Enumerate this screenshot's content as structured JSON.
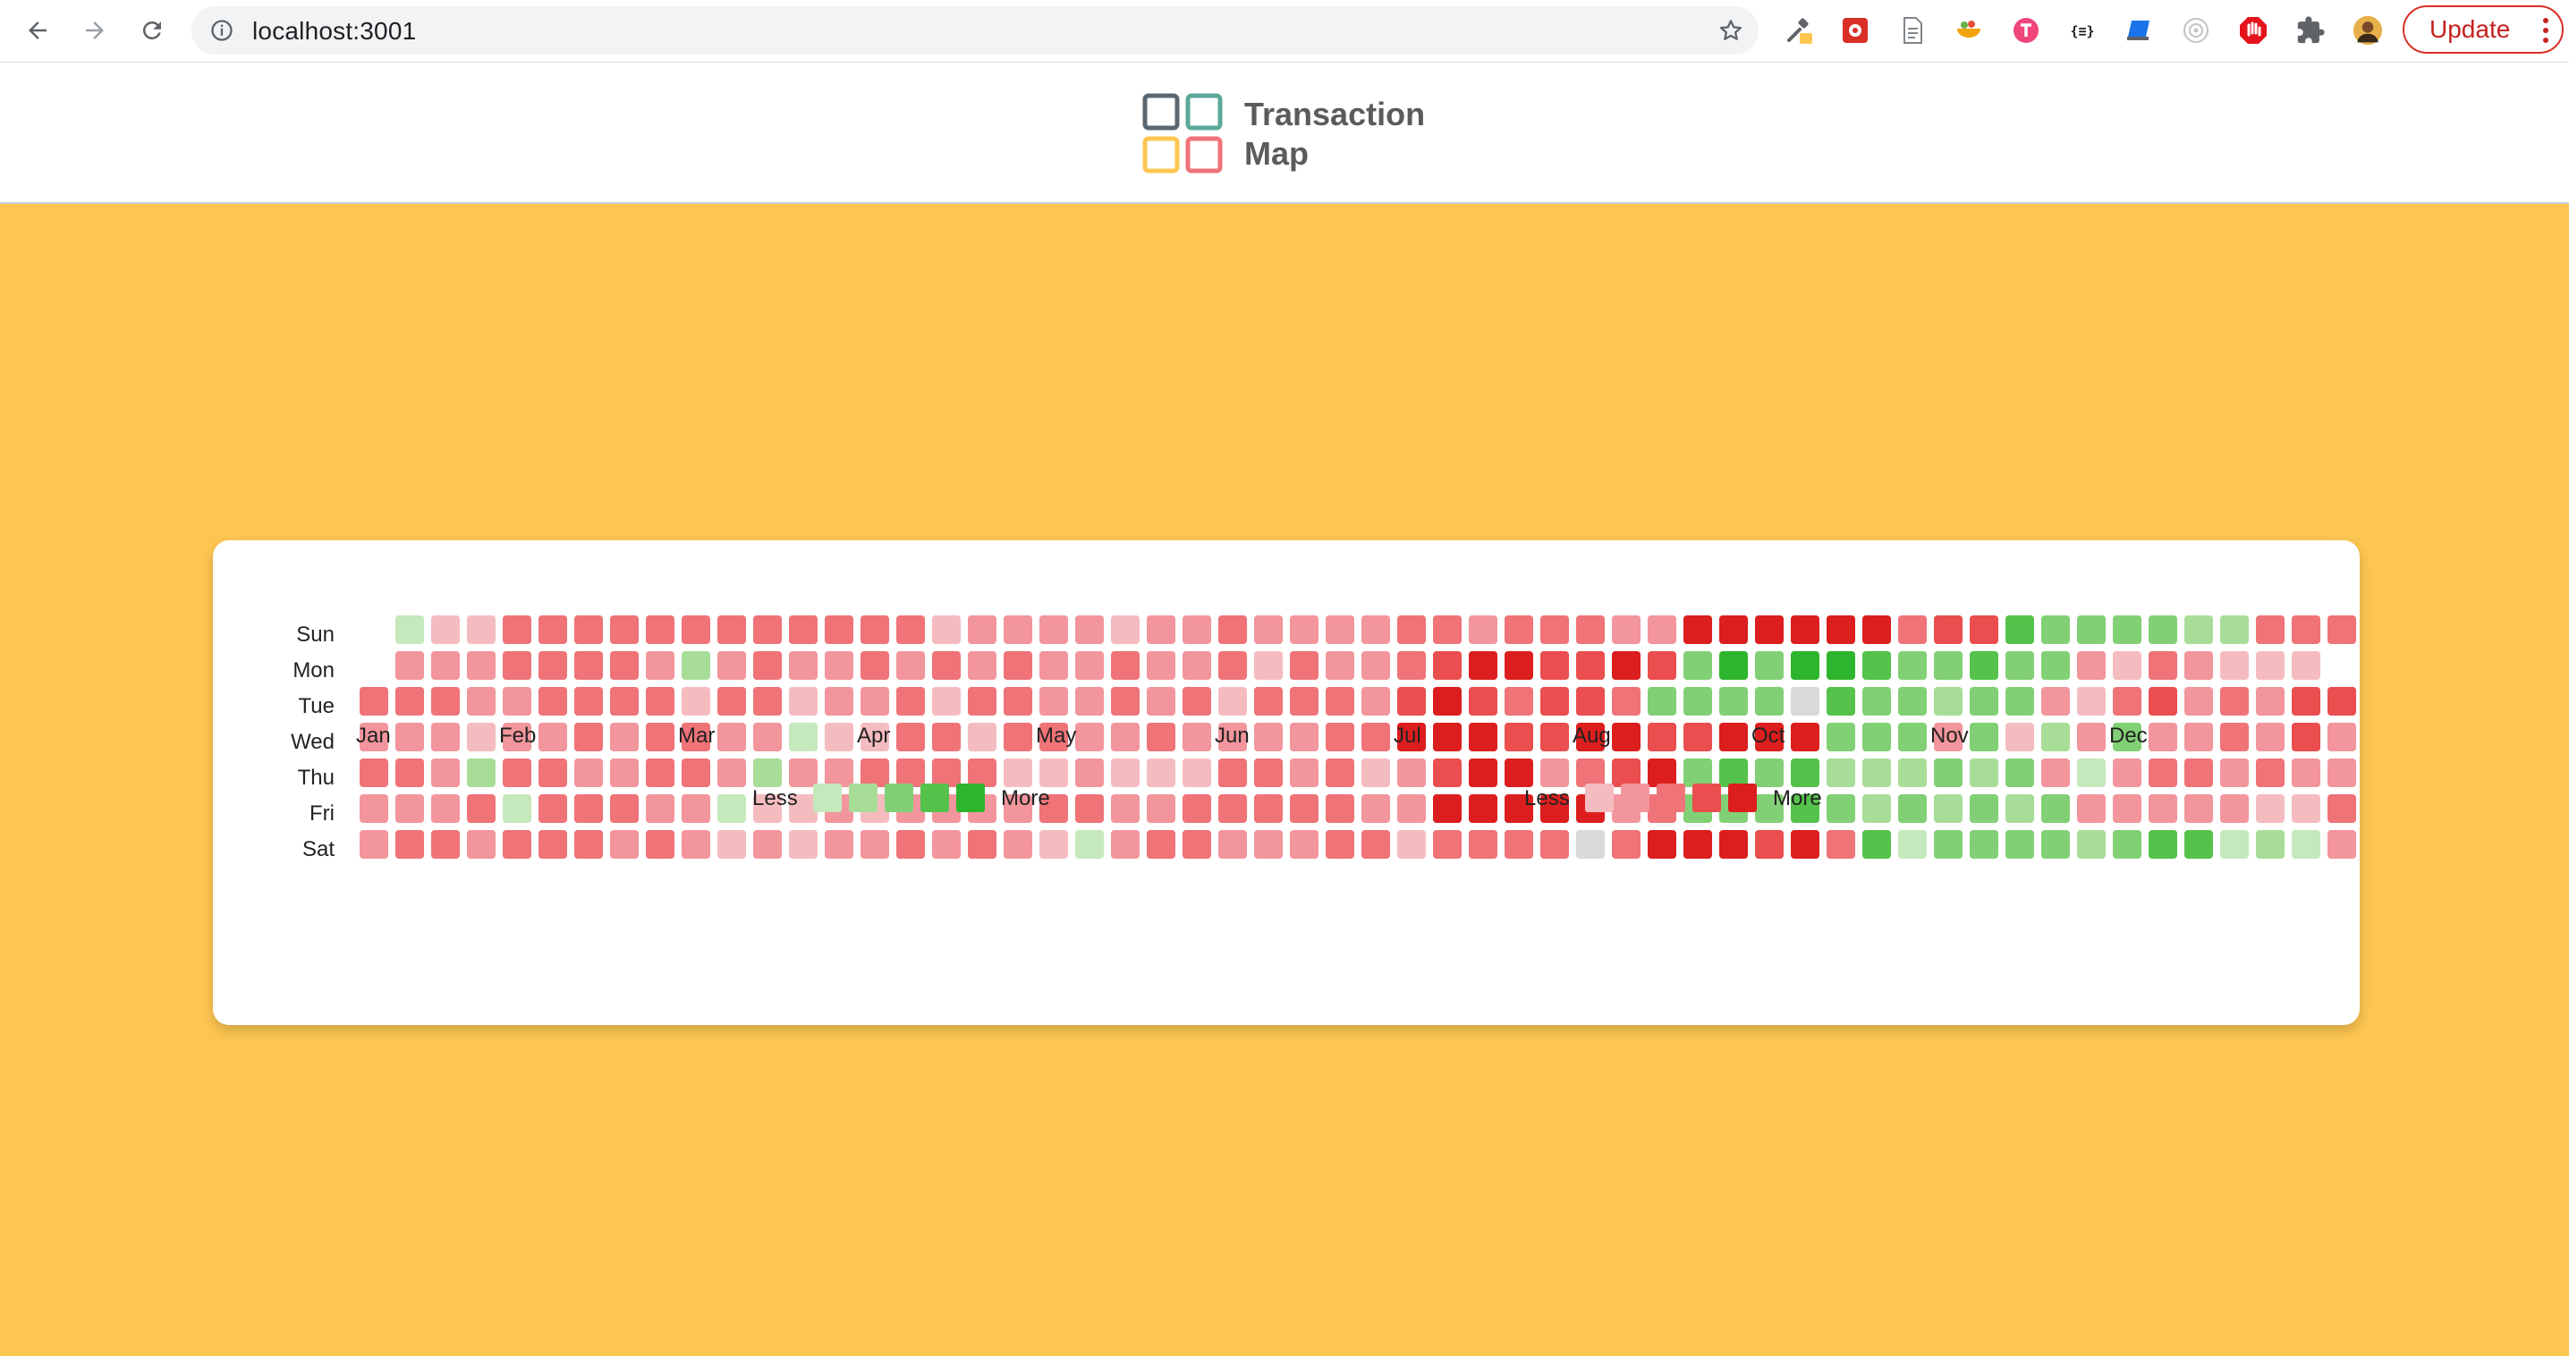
{
  "browser": {
    "url": "localhost:3001",
    "update_label": "Update",
    "extensions": [
      "eyedropper-icon",
      "puzzle-red-icon",
      "document-icon",
      "bowl-icon",
      "t-circle-icon",
      "json-braces-icon",
      "laptop-icon",
      "target-icon",
      "stop-hand-icon",
      "puzzle-icon",
      "avatar"
    ]
  },
  "header": {
    "brand_line1": "Transaction",
    "brand_line2": "Map",
    "logo_colors": [
      "#5b6770",
      "#5aa99a",
      "#fdc651",
      "#f0727a"
    ]
  },
  "heatmap": {
    "days": [
      "Sun",
      "Mon",
      "Tue",
      "Wed",
      "Thu",
      "Fri",
      "Sat"
    ],
    "months": [
      "Jan",
      "Feb",
      "Mar",
      "Apr",
      "May",
      "Jun",
      "Jul",
      "Aug",
      "Oct",
      "Nov",
      "Dec"
    ],
    "month_weeks": [
      0,
      4,
      9,
      14,
      19,
      24,
      29,
      34,
      39,
      44,
      49
    ],
    "legend_less": "Less",
    "legend_more": "More",
    "green_scale": [
      "#c5e8bc",
      "#a8dd98",
      "#82d075",
      "#55c24b",
      "#2eb52e"
    ],
    "red_scale": [
      "#f5bcc0",
      "#f2959c",
      "#ef7377",
      "#ea4e4e",
      "#dc1e1e"
    ],
    "empty_color": "#d9d9d9",
    "cell_rows": [
      " 1aaccccccccccccabbbbabbcbbbbccbcccbbeeeeeecdd4333322ccccca0b0",
      " bbbccccb2bcbbcbcbcbbcbbcacbbcdeedded35355433433bacbaaa",
      "cccbbccccaccabbcaccbbcbcacccbdedcddc33330433233bacdbcbdd",
      "bbbabbcbccbb1aaccaccbbcbbbbcceeeddeeddeee333b3a2b3bbcbdbbcbcac",
      "ccb2ccbbccb2bbccccaabaaaccbcabdeebcde3434222323b1bccbcbb0",
      "bbbc1cccbb1aababbbbccbbcccccbbeeeeebc33343232323bbbbbaacc0",
      "bccbcccbcbababbcbcba1bccbbbccacccc0ceeedec4133332344121bbcbbbb0"
    ]
  }
}
